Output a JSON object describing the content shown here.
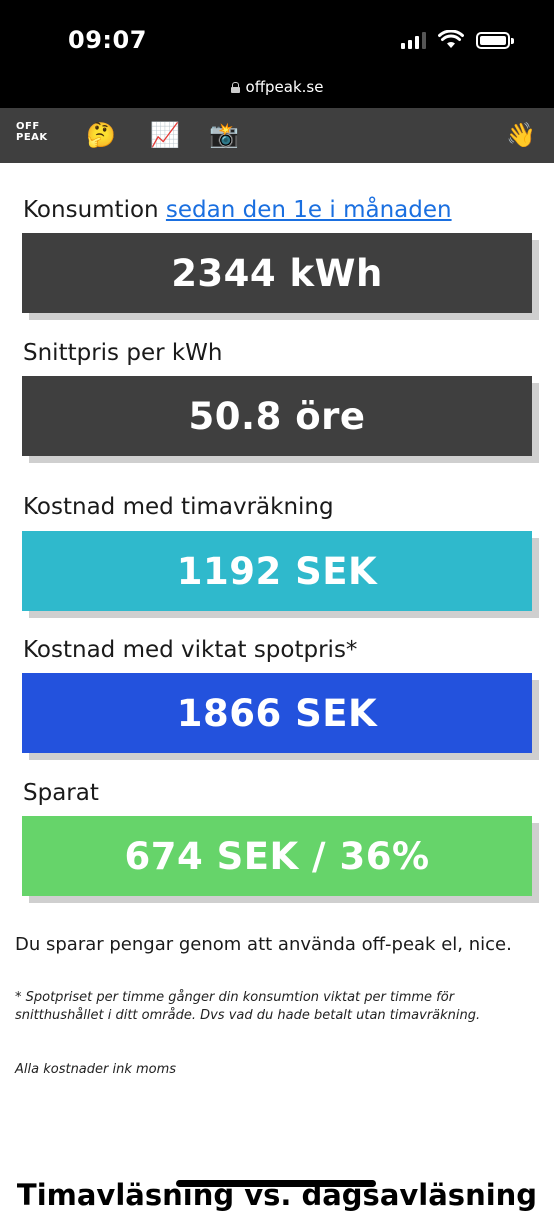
{
  "status_bar": {
    "time": "09:07",
    "icons": [
      "cellular-signal-icon",
      "wifi-icon",
      "battery-icon"
    ]
  },
  "browser": {
    "url": "offpeak.se"
  },
  "app_nav": {
    "logo_line1": "OFF",
    "logo_line2": "PEAK",
    "items": [
      {
        "icon": "thinking-face-icon",
        "glyph": "🤔"
      },
      {
        "icon": "chart-increasing-icon",
        "glyph": "📈"
      },
      {
        "icon": "camera-flash-icon",
        "glyph": "📸"
      },
      {
        "icon": "waving-hand-icon",
        "glyph": "👋"
      }
    ]
  },
  "stats": {
    "consumption": {
      "label": "Konsumtion",
      "link": "sedan den 1e i månaden",
      "value": "2344 kWh",
      "color": "#3f3f3f"
    },
    "avg_price": {
      "label": "Snittpris per kWh",
      "value": "50.8 öre",
      "color": "#3f3f3f"
    },
    "hourly_cost": {
      "label": "Kostnad med timavräkning",
      "value": "1192 SEK",
      "color": "#2fb9cc"
    },
    "spot_cost": {
      "label": "Kostnad med viktat spotpris*",
      "value": "1866 SEK",
      "color": "#2352dd"
    },
    "saved": {
      "label": "Sparat",
      "value": "674 SEK / 36%",
      "color": "#66d46a"
    }
  },
  "notes": {
    "main": "Du sparar pengar genom att använda off-peak el, nice.",
    "footnote": "* Spotpriset per timme gånger din konsumtion viktat per timme för snitthushållet i ditt område. Dvs vad du hade betalt utan timavräkning.",
    "vat": "Alla kostnader ink moms"
  },
  "next_section": {
    "heading": "Timavläsning vs. dagsavläsning"
  }
}
